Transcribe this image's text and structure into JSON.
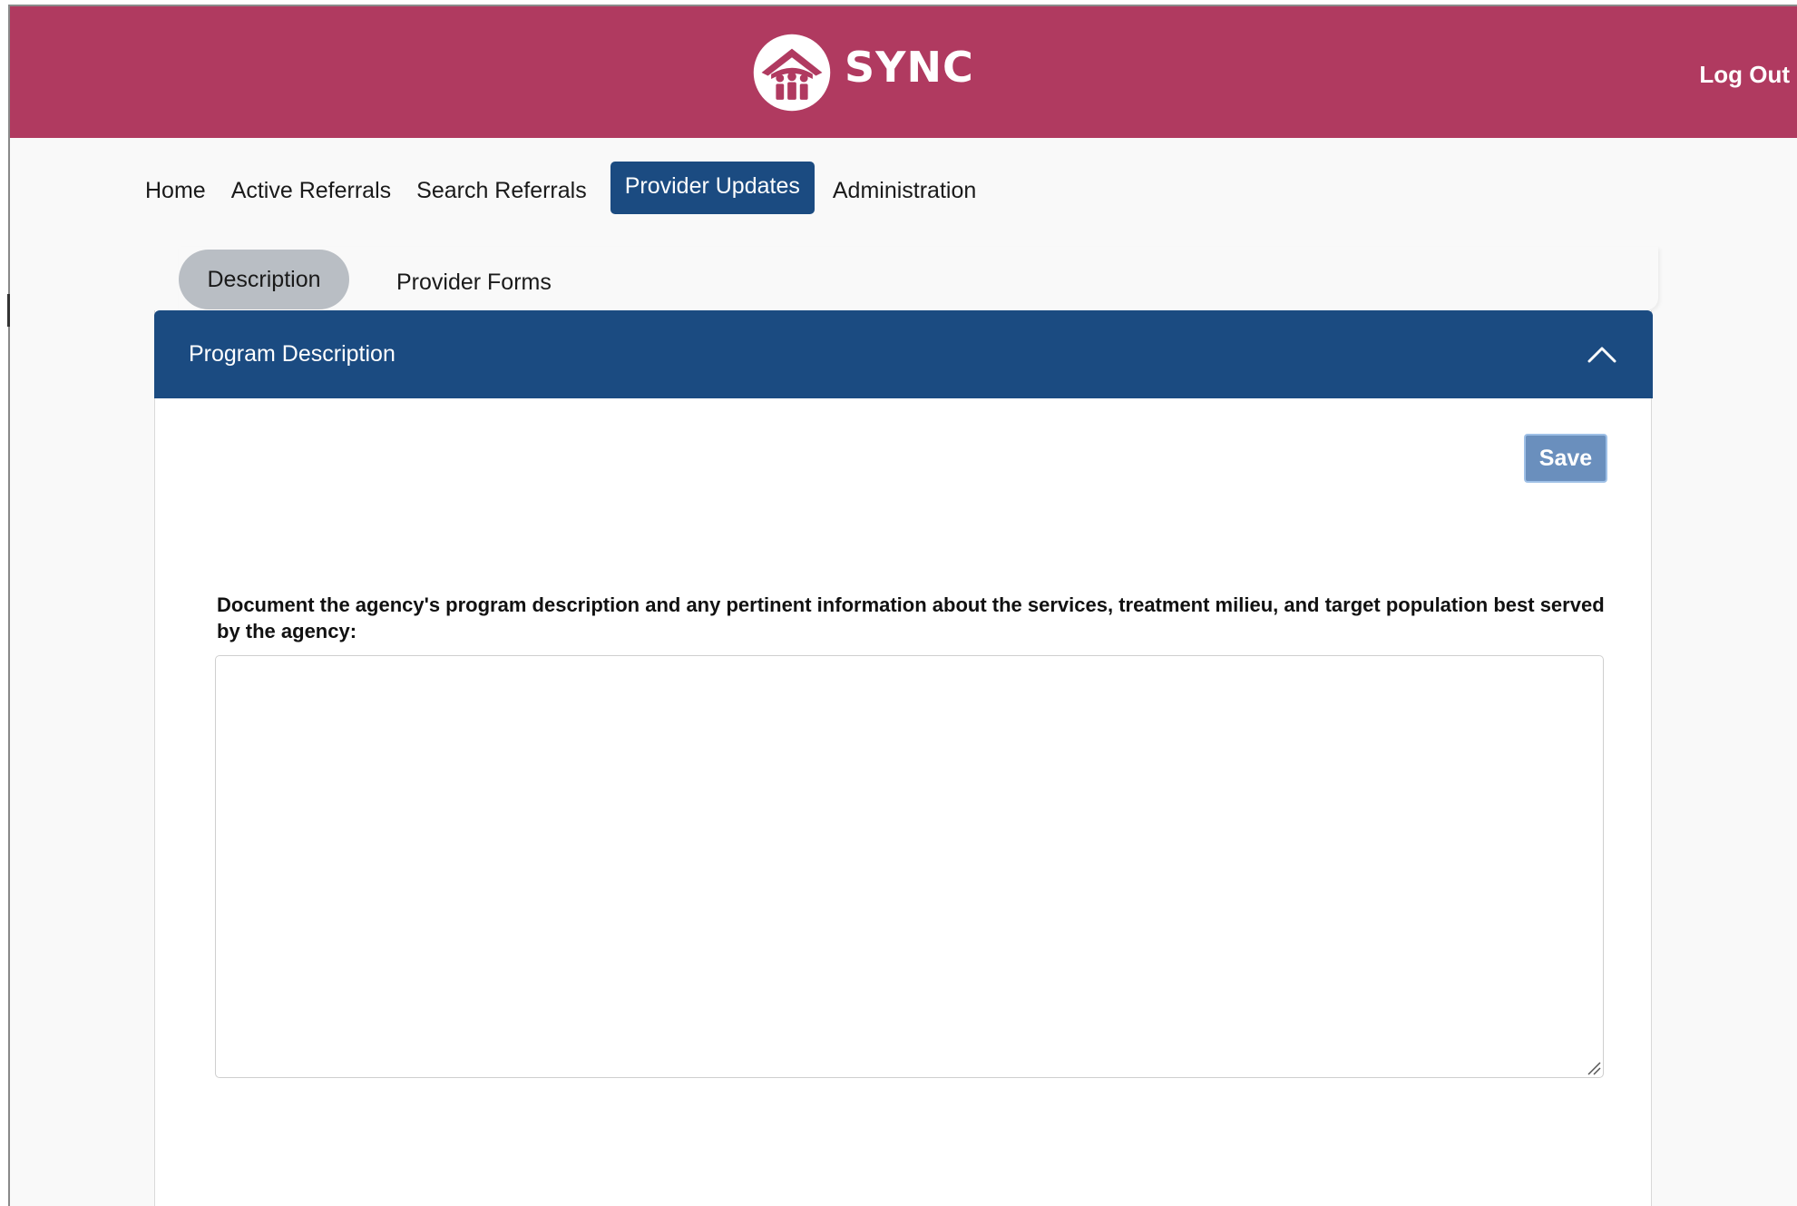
{
  "header": {
    "app_name": "SYNC",
    "logo_icon": "house-family-icon",
    "logout_label": "Log Out",
    "color": "#b03a60"
  },
  "nav": {
    "items": [
      {
        "label": "Home",
        "active": false
      },
      {
        "label": "Active Referrals",
        "active": false
      },
      {
        "label": "Search Referrals",
        "active": false
      },
      {
        "label": "Provider Updates",
        "active": true
      },
      {
        "label": "Administration",
        "active": false
      }
    ],
    "active_color": "#1b4b81"
  },
  "subtabs": {
    "items": [
      {
        "label": "Description",
        "active": true
      },
      {
        "label": "Provider Forms",
        "active": false
      }
    ]
  },
  "panel": {
    "title": "Program Description",
    "collapse_icon": "chevron-up-icon",
    "save_label": "Save",
    "prompt": "Document the agency's program description and any pertinent information about the services, treatment milieu, and target population best served by the agency:",
    "description_value": "",
    "header_color": "#1b4b81"
  }
}
